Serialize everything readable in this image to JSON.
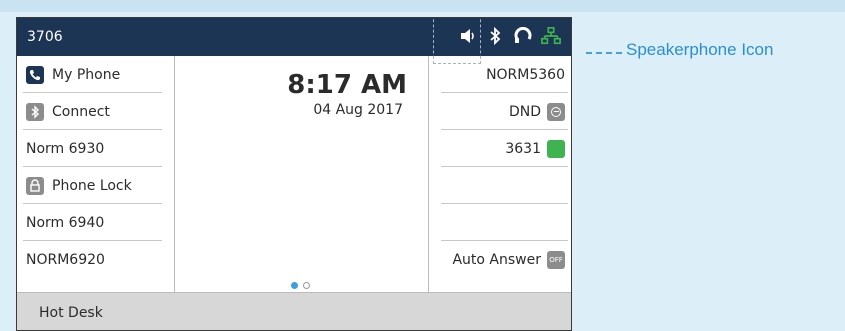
{
  "header": {
    "extension": "3706"
  },
  "icons": {
    "speaker": "speakerphone-icon",
    "bluetooth": "bluetooth-icon",
    "headset": "headset-icon",
    "network": "network-icon"
  },
  "left_keys": [
    {
      "label": "My Phone",
      "icon": "phone-icon"
    },
    {
      "label": "Connect",
      "icon": "bluetooth-icon"
    },
    {
      "label": "Norm 6930"
    },
    {
      "label": "Phone Lock",
      "icon": "lock-icon"
    },
    {
      "label": "Norm 6940"
    },
    {
      "label": "NORM6920"
    }
  ],
  "center": {
    "time": "8:17 AM",
    "date": "04 Aug 2017",
    "page_dots": 2,
    "active_page": 1
  },
  "right_keys": [
    {
      "label": "NORM5360"
    },
    {
      "label": "DND",
      "status": "dnd-off"
    },
    {
      "label": "3631",
      "status": "active"
    },
    {
      "label": ""
    },
    {
      "label": ""
    },
    {
      "label": "Auto Answer",
      "toggle": "OFF"
    }
  ],
  "bottom_bar": {
    "label": "Hot Desk"
  },
  "callout": {
    "label": "Speakerphone Icon"
  },
  "colors": {
    "header_bg": "#1c3554",
    "accent_green": "#3fb34f",
    "callout_blue": "#2a8fd0"
  }
}
